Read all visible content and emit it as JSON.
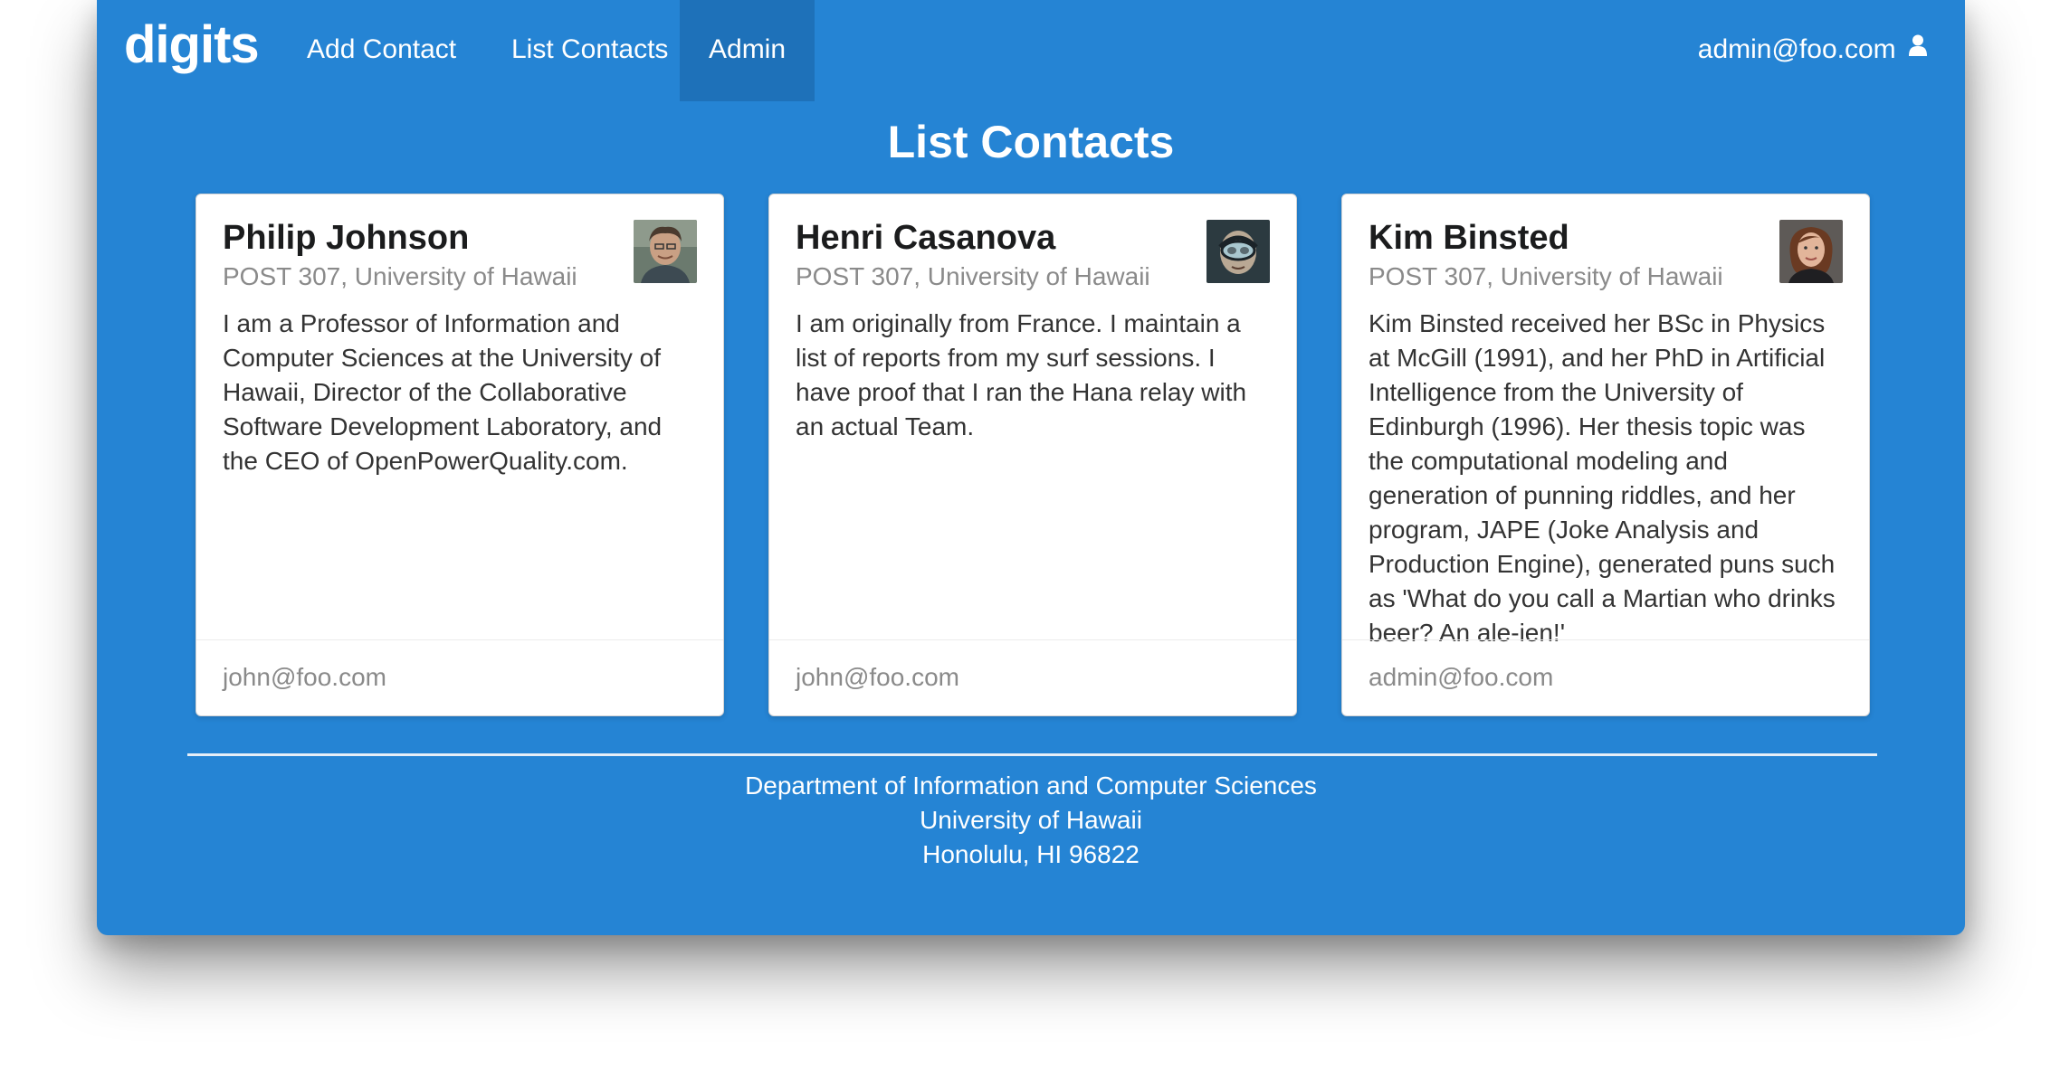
{
  "navbar": {
    "brand": "digits",
    "items": [
      {
        "label": "Add Contact"
      },
      {
        "label": "List Contacts"
      },
      {
        "label": "Admin",
        "active": true
      }
    ],
    "user": "admin@foo.com",
    "user_icon": "user-icon"
  },
  "page": {
    "title": "List Contacts"
  },
  "contacts": [
    {
      "name": "Philip Johnson",
      "address": "POST 307, University of Hawaii",
      "description": "I am a Professor of Information and Computer Sciences at the University of Hawaii, Director of the Collaborative Software Development Laboratory, and the CEO of OpenPowerQuality.com.",
      "owner": "john@foo.com",
      "avatar": "avatar-philip-johnson"
    },
    {
      "name": "Henri Casanova",
      "address": "POST 307, University of Hawaii",
      "description": "I am originally from France. I maintain a list of reports from my surf sessions. I have proof that I ran the Hana relay with an actual Team.",
      "owner": "john@foo.com",
      "avatar": "avatar-henri-casanova"
    },
    {
      "name": "Kim Binsted",
      "address": "POST 307, University of Hawaii",
      "description": "Kim Binsted received her BSc in Physics at McGill (1991), and her PhD in Artificial Intelligence from the University of Edinburgh (1996). Her thesis topic was the computational modeling and generation of punning riddles, and her program, JAPE (Joke Analysis and Production Engine), generated puns such as 'What do you call a Martian who drinks beer? An ale-ien!'",
      "owner": "admin@foo.com",
      "avatar": "avatar-kim-binsted"
    }
  ],
  "footer": {
    "line1": "Department of Information and Computer Sciences",
    "line2": "University of Hawaii",
    "line3": "Honolulu, HI 96822"
  },
  "colors": {
    "primary": "#2584d4",
    "nav_active": "#1e71b9",
    "card_bg": "#ffffff",
    "meta_text": "#8a8a8a"
  }
}
